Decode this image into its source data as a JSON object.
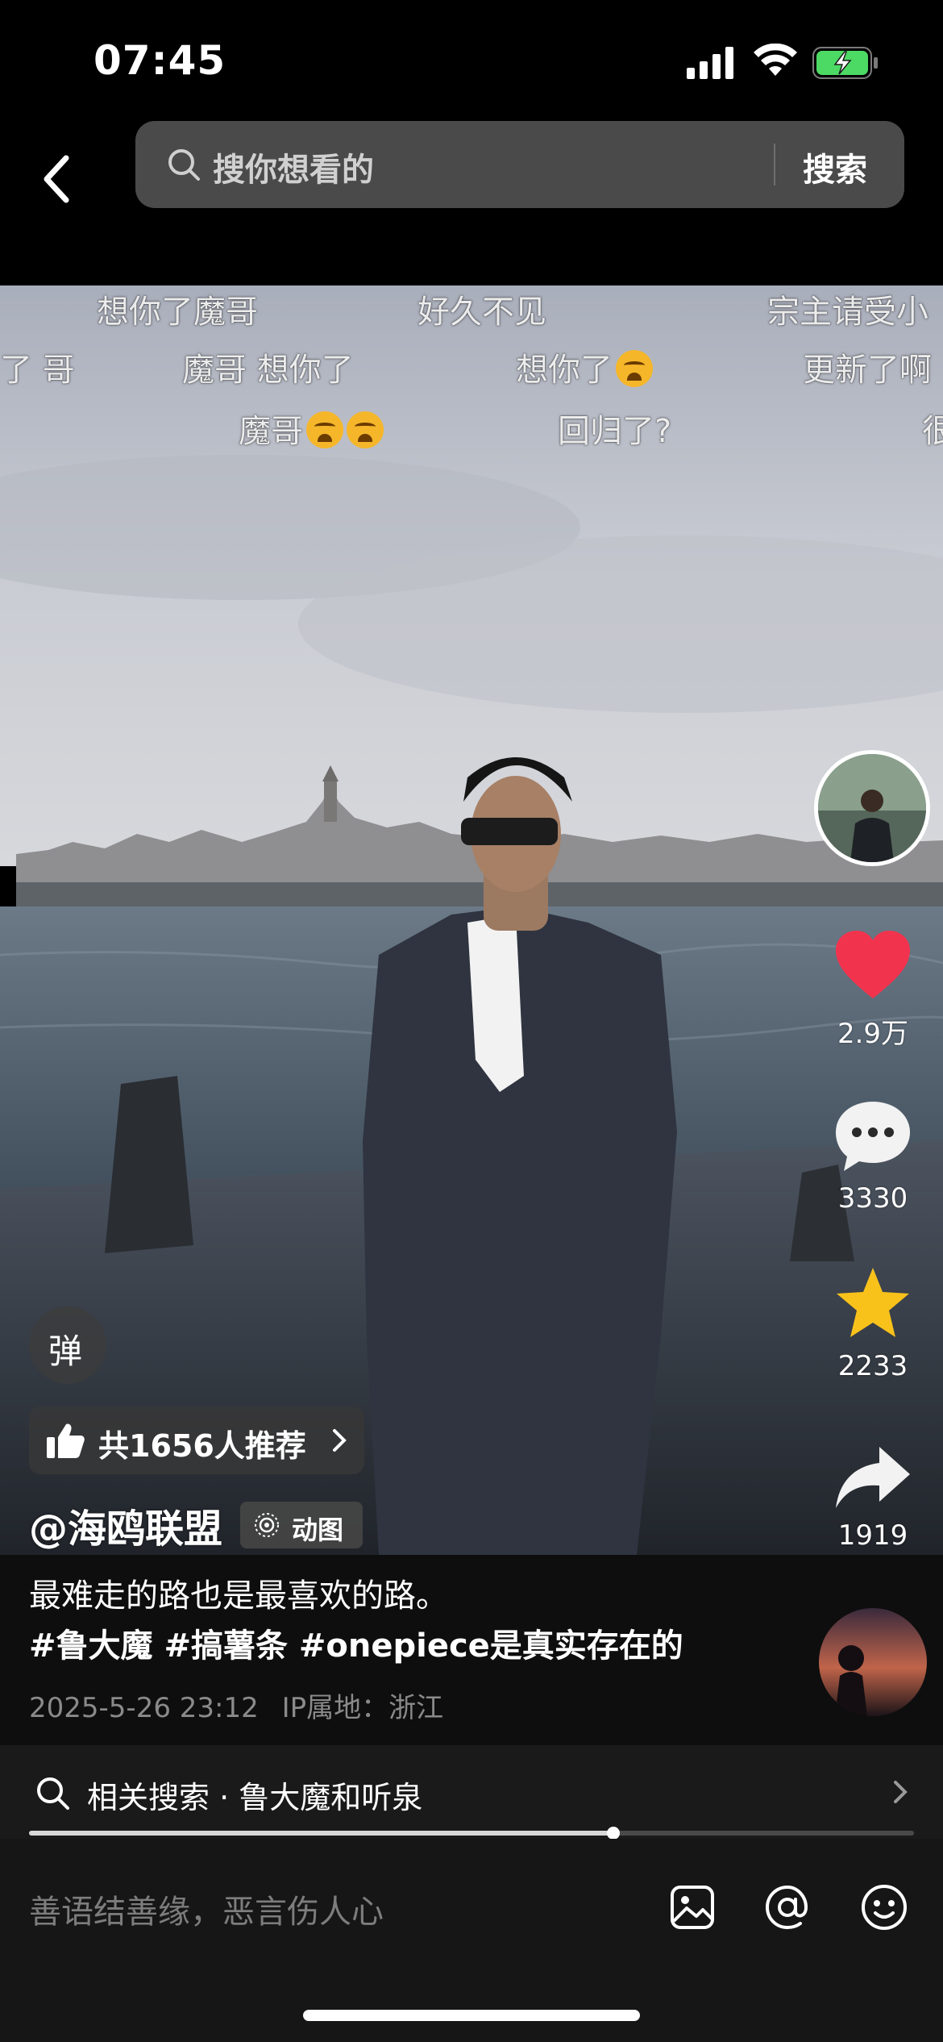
{
  "status_bar": {
    "time": "07:45"
  },
  "search": {
    "placeholder": "搜你想看的",
    "button_label": "搜索"
  },
  "danmaku": [
    {
      "text": "想你了魔哥"
    },
    {
      "text": "好久不见"
    },
    {
      "text": "宗主请受小"
    },
    {
      "text": "了 哥"
    },
    {
      "text": "魔哥 想你了"
    },
    {
      "text": "想你了"
    },
    {
      "text": "更新了啊"
    },
    {
      "text": "魔哥"
    },
    {
      "text": "回归了?"
    },
    {
      "text": "很"
    }
  ],
  "actions": {
    "likes": "2.9万",
    "comments": "3330",
    "favorites": "2233",
    "shares": "1919"
  },
  "colors": {
    "like": "#f2334d",
    "favorite": "#f9c21b",
    "background": "#000000"
  },
  "danmu_toggle_label": "弹",
  "recommend": {
    "label": "共1656人推荐"
  },
  "author": {
    "handle": "@海鸥联盟",
    "tag_label": "动图"
  },
  "caption": {
    "text": "最难走的路也是最喜欢的路。",
    "hashtags": "#鲁大魔 #搞薯条 #onepiece是真实存在的",
    "date": "2025-5-26 23:12",
    "ip_location": "IP属地：浙江"
  },
  "related_search": {
    "label": "相关搜索 · 鲁大魔和听泉"
  },
  "playback": {
    "progress_fraction": 0.66
  },
  "comment_bar": {
    "placeholder": "善语结善缘，恶言伤人心"
  },
  "icons": [
    "back-arrow-icon",
    "search-icon",
    "signal-icon",
    "wifi-icon",
    "battery-charging-icon",
    "heart-icon",
    "comment-icon",
    "star-icon",
    "share-icon",
    "thumbs-up-icon",
    "chevron-right-icon",
    "image-icon",
    "at-icon",
    "emoji-icon"
  ]
}
